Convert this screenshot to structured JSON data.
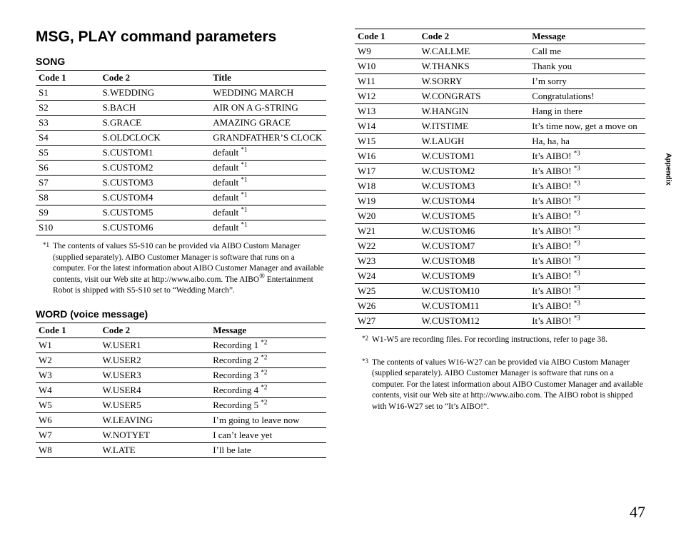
{
  "title": "MSG, PLAY command parameters",
  "side_tab": "Appendix",
  "page_number": "47",
  "song": {
    "heading": "SONG",
    "headers": [
      "Code 1",
      "Code 2",
      "Title"
    ],
    "rows": [
      {
        "c1": "S1",
        "c2": "S.WEDDING",
        "c3": "WEDDING MARCH",
        "sup": ""
      },
      {
        "c1": "S2",
        "c2": "S.BACH",
        "c3": "AIR ON A G-STRING",
        "sup": ""
      },
      {
        "c1": "S3",
        "c2": "S.GRACE",
        "c3": "AMAZING GRACE",
        "sup": ""
      },
      {
        "c1": "S4",
        "c2": "S.OLDCLOCK",
        "c3": "GRANDFATHER’S CLOCK",
        "sup": ""
      },
      {
        "c1": "S5",
        "c2": "S.CUSTOM1",
        "c3": "default ",
        "sup": "*1"
      },
      {
        "c1": "S6",
        "c2": "S.CUSTOM2",
        "c3": "default ",
        "sup": "*1"
      },
      {
        "c1": "S7",
        "c2": "S.CUSTOM3",
        "c3": "default ",
        "sup": "*1"
      },
      {
        "c1": "S8",
        "c2": "S.CUSTOM4",
        "c3": "default ",
        "sup": "*1"
      },
      {
        "c1": "S9",
        "c2": "S.CUSTOM5",
        "c3": "default ",
        "sup": "*1"
      },
      {
        "c1": "S10",
        "c2": "S.CUSTOM6",
        "c3": "default ",
        "sup": "*1"
      }
    ],
    "footnote_mark": "*1",
    "footnote_body_pre": "The contents of values S5-S10 can be provided via AIBO Custom Manager (supplied separately). AIBO Customer Manager is software that runs on a computer. For the latest information about AIBO Customer Manager and available contents, visit our Web site at http://www.aibo.com. The AIBO",
    "footnote_reg": "®",
    "footnote_body_post": " Entertainment Robot is shipped with S5-S10 set to “Wedding March”."
  },
  "word": {
    "heading": "WORD (voice message)",
    "headers": [
      "Code 1",
      "Code 2",
      "Message"
    ],
    "rows_left": [
      {
        "c1": "W1",
        "c2": "W.USER1",
        "c3": "Recording 1 ",
        "sup": "*2"
      },
      {
        "c1": "W2",
        "c2": "W.USER2",
        "c3": "Recording 2 ",
        "sup": "*2"
      },
      {
        "c1": "W3",
        "c2": "W.USER3",
        "c3": "Recording 3 ",
        "sup": "*2"
      },
      {
        "c1": "W4",
        "c2": "W.USER4",
        "c3": "Recording 4 ",
        "sup": "*2"
      },
      {
        "c1": "W5",
        "c2": "W.USER5",
        "c3": "Recording 5 ",
        "sup": "*2"
      },
      {
        "c1": "W6",
        "c2": "W.LEAVING",
        "c3": "I’m going to leave now",
        "sup": ""
      },
      {
        "c1": "W7",
        "c2": "W.NOTYET",
        "c3": "I can’t leave yet",
        "sup": ""
      },
      {
        "c1": "W8",
        "c2": "W.LATE",
        "c3": "I’ll be late",
        "sup": ""
      }
    ],
    "rows_right": [
      {
        "c1": "W9",
        "c2": "W.CALLME",
        "c3": "Call me",
        "sup": ""
      },
      {
        "c1": "W10",
        "c2": "W.THANKS",
        "c3": "Thank you",
        "sup": ""
      },
      {
        "c1": "W11",
        "c2": "W.SORRY",
        "c3": "I’m sorry",
        "sup": ""
      },
      {
        "c1": "W12",
        "c2": "W.CONGRATS",
        "c3": "Congratulations!",
        "sup": ""
      },
      {
        "c1": "W13",
        "c2": "W.HANGIN",
        "c3": "Hang in there",
        "sup": ""
      },
      {
        "c1": "W14",
        "c2": "W.ITSTIME",
        "c3": "It’s time now, get a move on",
        "sup": ""
      },
      {
        "c1": "W15",
        "c2": "W.LAUGH",
        "c3": "Ha, ha, ha",
        "sup": ""
      },
      {
        "c1": "W16",
        "c2": "W.CUSTOM1",
        "c3": "It’s AIBO! ",
        "sup": "*3"
      },
      {
        "c1": "W17",
        "c2": "W.CUSTOM2",
        "c3": "It’s AIBO! ",
        "sup": "*3"
      },
      {
        "c1": "W18",
        "c2": "W.CUSTOM3",
        "c3": "It’s AIBO! ",
        "sup": "*3"
      },
      {
        "c1": "W19",
        "c2": "W.CUSTOM4",
        "c3": "It’s AIBO! ",
        "sup": "*3"
      },
      {
        "c1": "W20",
        "c2": "W.CUSTOM5",
        "c3": "It’s AIBO! ",
        "sup": "*3"
      },
      {
        "c1": "W21",
        "c2": "W.CUSTOM6",
        "c3": "It’s AIBO! ",
        "sup": "*3"
      },
      {
        "c1": "W22",
        "c2": "W.CUSTOM7",
        "c3": "It’s AIBO! ",
        "sup": "*3"
      },
      {
        "c1": "W23",
        "c2": "W.CUSTOM8",
        "c3": "It’s AIBO! ",
        "sup": "*3"
      },
      {
        "c1": "W24",
        "c2": "W.CUSTOM9",
        "c3": "It’s AIBO! ",
        "sup": "*3"
      },
      {
        "c1": "W25",
        "c2": "W.CUSTOM10",
        "c3": "It’s AIBO! ",
        "sup": "*3"
      },
      {
        "c1": "W26",
        "c2": "W.CUSTOM11",
        "c3": "It’s AIBO! ",
        "sup": "*3"
      },
      {
        "c1": "W27",
        "c2": "W.CUSTOM12",
        "c3": "It’s AIBO! ",
        "sup": "*3"
      }
    ],
    "footnote2_mark": "*2",
    "footnote2_body": "W1-W5 are recording files. For recording instructions, refer to page 38.",
    "footnote3_mark": "*3",
    "footnote3_body": "The contents of values W16-W27 can be provided via AIBO Custom Manager (supplied separately). AIBO Customer Manager is software that runs on a computer. For the latest information about AIBO Customer Manager and available contents, visit our Web site at http://www.aibo.com. The AIBO robot is shipped with W16-W27 set to “It’s AIBO!”."
  }
}
